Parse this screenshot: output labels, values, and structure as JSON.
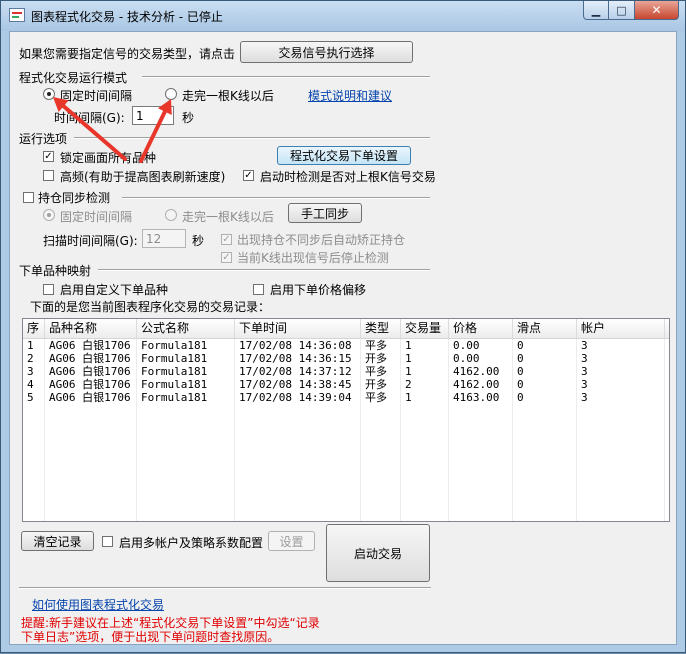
{
  "window": {
    "title": "图表程式化交易 - 技术分析 - 已停止",
    "controls": {
      "minimize": "▁",
      "maximize": "□",
      "close": "✕"
    }
  },
  "signal": {
    "prompt": "如果您需要指定信号的交易类型，请点击",
    "button": "交易信号执行选择"
  },
  "mode": {
    "title": "程式化交易运行模式",
    "fixed_interval": "固定时间间隔",
    "after_bar": "走完一根K线以后",
    "help_link": "模式说明和建议",
    "interval_label": "时间间隔(G):",
    "interval_value": "1",
    "interval_unit": "秒"
  },
  "options": {
    "title": "运行选项",
    "lock_product": "锁定画面所有品种",
    "lock_product_checked": true,
    "order_settings_button": "程式化交易下单设置",
    "high_freq": "高频(有助于提高图表刷新速度)",
    "high_freq_checked": false,
    "check_signal": "启动时检测是否对上根K信号交易",
    "check_signal_checked": true
  },
  "sync": {
    "title": "持仓同步检测",
    "checked": false,
    "fixed_interval": "固定时间间隔",
    "after_bar": "走完一根K线以后",
    "manual_button": "手工同步",
    "scan_label": "扫描时间间隔(G):",
    "scan_value": "12",
    "scan_unit": "秒",
    "auto_correct": "出现持仓不同步后自动矫正持仓",
    "auto_correct_checked": true,
    "stop_detect": "当前K线出现信号后停止检测",
    "stop_detect_checked": true
  },
  "mapping": {
    "title": "下单品种映射",
    "custom_product": "启用自定义下单品种",
    "custom_product_checked": false,
    "price_offset": "启用下单价格偏移",
    "price_offset_checked": false
  },
  "records": {
    "caption": "下面的是您当前图表程序化交易的交易记录：",
    "columns": [
      "序",
      "品种名称",
      "公式名称",
      "下单时间",
      "类型",
      "交易量",
      "价格",
      "滑点",
      "帐户"
    ],
    "rows": [
      [
        "1",
        "AG06 白银1706",
        "Formula181",
        "17/02/08 14:36:08",
        "平多",
        "1",
        "0.00",
        "0",
        "3"
      ],
      [
        "2",
        "AG06 白银1706",
        "Formula181",
        "17/02/08 14:36:15",
        "开多",
        "1",
        "0.00",
        "0",
        "3"
      ],
      [
        "3",
        "AG06 白银1706",
        "Formula181",
        "17/02/08 14:37:12",
        "平多",
        "1",
        "4162.00",
        "0",
        "3"
      ],
      [
        "4",
        "AG06 白银1706",
        "Formula181",
        "17/02/08 14:38:45",
        "开多",
        "2",
        "4162.00",
        "0",
        "3"
      ],
      [
        "5",
        "AG06 白银1706",
        "Formula181",
        "17/02/08 14:39:04",
        "平多",
        "1",
        "4163.00",
        "0",
        "3"
      ]
    ]
  },
  "bottom": {
    "clear_button": "清空记录",
    "multi_account": "启用多帐户及策略系数配置",
    "multi_account_checked": false,
    "settings_button": "设置",
    "start_button": "启动交易",
    "howto_link": "如何使用图表程式化交易",
    "tip_line1": "提醒:新手建议在上述“程式化交易下单设置”中勾选“记录",
    "tip_line2": "下单日志”选项，便于出现下单问题时查找原因。"
  },
  "colors": {
    "annotation_arrow": "#e8362a",
    "link": "#0645ad",
    "tip_text": "#e00000"
  },
  "icons": {
    "app": "chart-app-icon",
    "check": "✓"
  }
}
